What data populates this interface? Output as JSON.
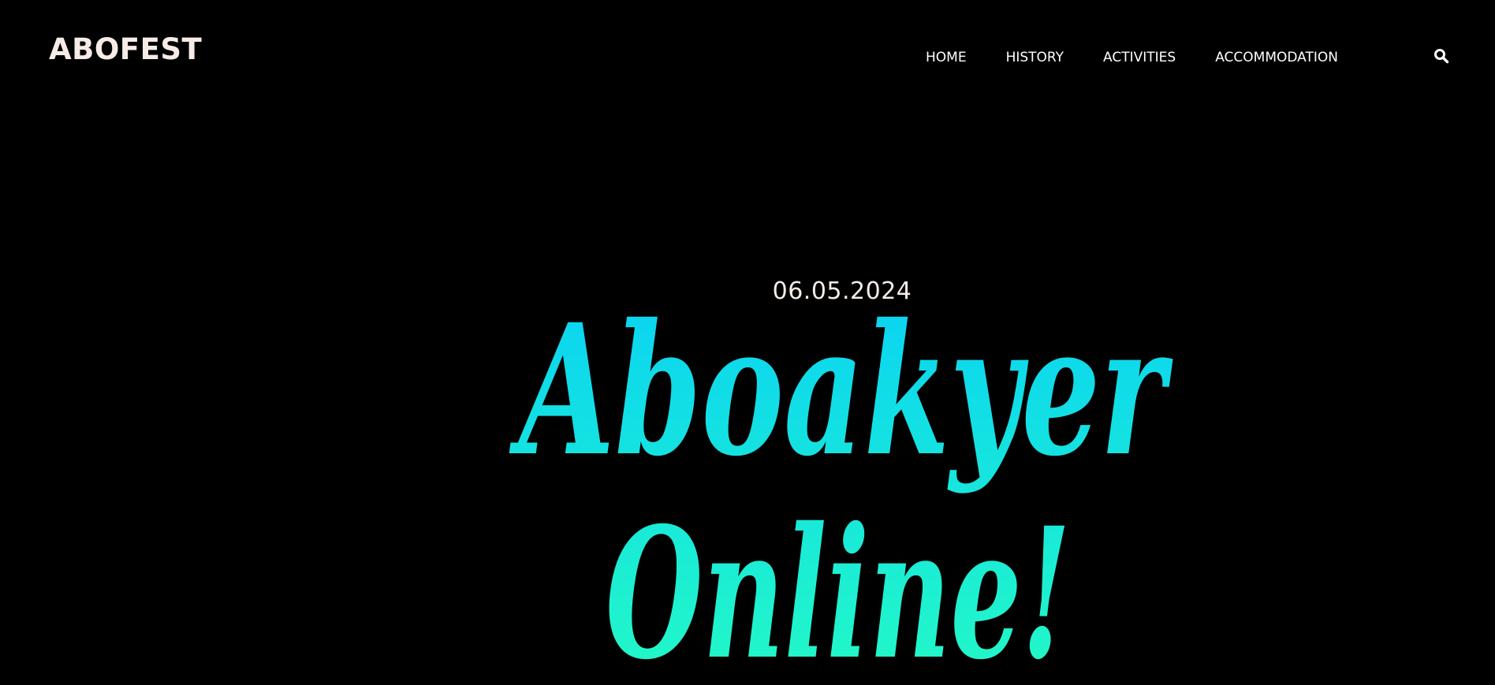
{
  "header": {
    "logo": "ABOFEST",
    "nav": [
      {
        "label": "HOME"
      },
      {
        "label": "HISTORY"
      },
      {
        "label": "ACTIVITIES"
      },
      {
        "label": "ACCOMMODATION"
      }
    ],
    "search_icon": "search-icon"
  },
  "hero": {
    "date": "06.05.2024",
    "title_line1": "Aboakyer",
    "title_line2": "Online!"
  },
  "colors": {
    "background": "#000000",
    "logo": "#f6ebe7",
    "nav_text": "#ffffff",
    "gradient_top": "#0ad3f3",
    "gradient_bottom": "#22f7c8"
  }
}
